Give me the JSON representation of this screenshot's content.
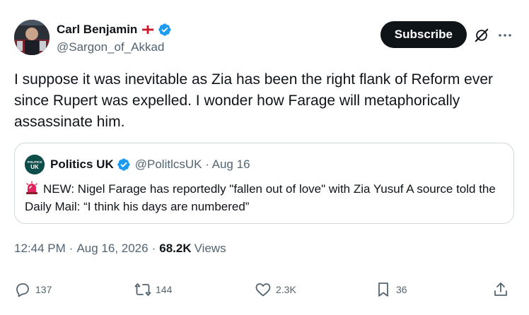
{
  "author": {
    "display_name": "Carl Benjamin",
    "handle": "@Sargon_of_Akkad"
  },
  "buttons": {
    "subscribe": "Subscribe"
  },
  "tweet": {
    "text": "I suppose it was inevitable as Zia has been the right flank of Reform ever since Rupert was expelled. I wonder how Farage will metaphorically assassinate him."
  },
  "quote": {
    "display_name": "Politics UK",
    "handle_date": "@PolitlcsUK · Aug 16",
    "avatar_text": "POLITICS UK",
    "text": "NEW: Nigel Farage has reportedly \"fallen out of love\" with Zia Yusuf A source told the Daily Mail: “I think his days are numbered”"
  },
  "meta": {
    "time": "12:44 PM",
    "date": "Aug 16, 2026",
    "views_count": "68.2K",
    "views_label": "Views"
  },
  "actions": {
    "replies": "137",
    "reposts": "144",
    "likes": "2.3K",
    "bookmarks": "36"
  },
  "colors": {
    "verified": "#1d9bf0",
    "secondary_text": "#536471",
    "primary_text": "#0f1419",
    "border": "#cfd9de"
  },
  "icons": [
    "grok-icon",
    "more-icon",
    "reply-icon",
    "repost-icon",
    "like-icon",
    "bookmark-icon",
    "share-icon",
    "verified-icon",
    "england-flag-icon",
    "siren-icon"
  ]
}
